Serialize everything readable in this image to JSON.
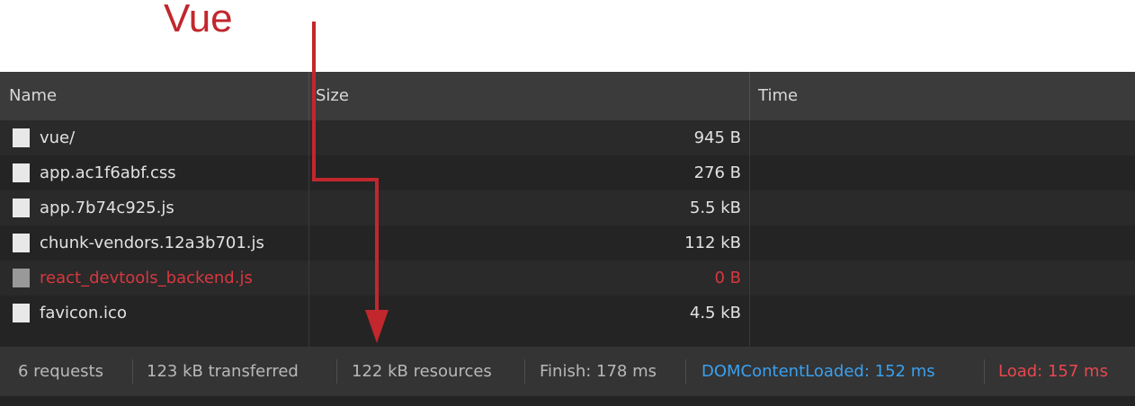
{
  "annotation": {
    "label": "Vue",
    "color": "#c1272d"
  },
  "table": {
    "columns": [
      "Name",
      "Size",
      "Time"
    ],
    "rows": [
      {
        "name": "vue/",
        "size": "945 B",
        "status": "normal"
      },
      {
        "name": "app.ac1f6abf.css",
        "size": "276 B",
        "status": "normal"
      },
      {
        "name": "app.7b74c925.js",
        "size": "5.5 kB",
        "status": "normal"
      },
      {
        "name": "chunk-vendors.12a3b701.js",
        "size": "112 kB",
        "status": "normal"
      },
      {
        "name": "react_devtools_backend.js",
        "size": "0 B",
        "status": "error"
      },
      {
        "name": "favicon.ico",
        "size": "4.5 kB",
        "status": "normal"
      }
    ]
  },
  "status_bar": {
    "requests": "6 requests",
    "transferred": "123 kB transferred",
    "resources": "122 kB resources",
    "finish": "Finish: 178 ms",
    "dom_content_loaded": "DOMContentLoaded: 152 ms",
    "load": "Load: 157 ms"
  },
  "colors": {
    "dom_content_loaded": "#3aa0ee",
    "load": "#e8474f",
    "error_text": "#d9373f"
  }
}
